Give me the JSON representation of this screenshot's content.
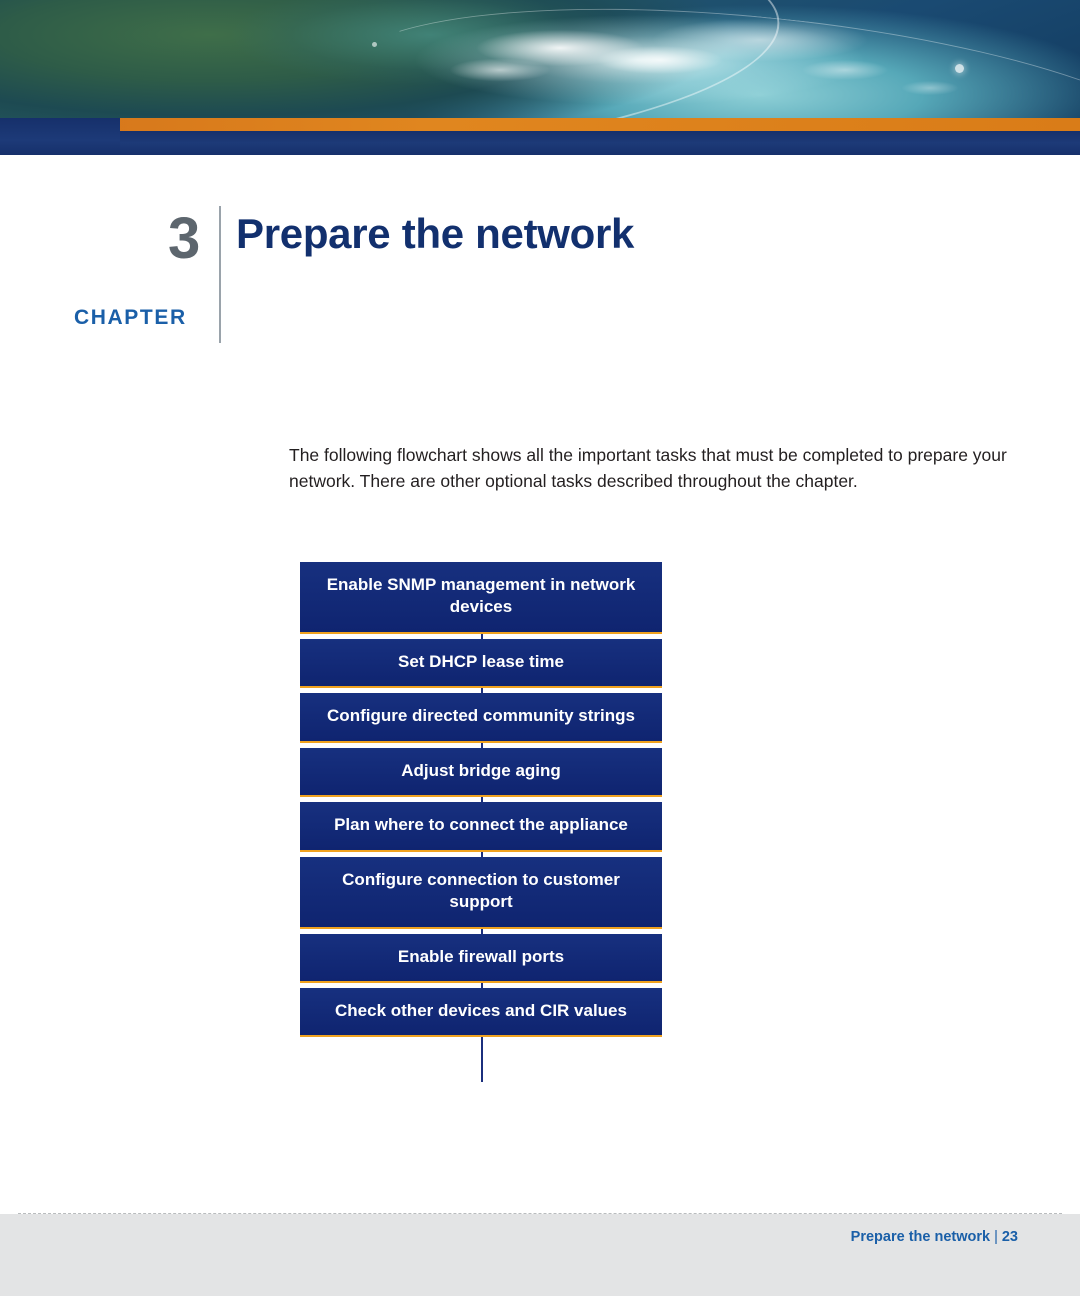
{
  "banner": {
    "icon_names": [
      "ocean-wave-photo",
      "sky-gradient",
      "orange-rule",
      "navy-rule",
      "light-dot"
    ]
  },
  "chapter": {
    "label": "CHAPTER",
    "number": "3",
    "title": "Prepare the network"
  },
  "intro": {
    "text": "The following flowchart shows all the important tasks that must be completed to prepare your network. There are other optional tasks described throughout the chapter."
  },
  "flowchart": {
    "type": "vertical-sequence",
    "accent_color": "#f0a21f",
    "box_color": "#132a7d",
    "text_color": "#ffffff",
    "steps": [
      "Enable SNMP management in network devices",
      "Set DHCP lease time",
      "Configure directed community strings",
      "Adjust bridge aging",
      "Plan where to connect the appliance",
      "Configure connection to customer support",
      "Enable firewall ports",
      "Check other devices and CIR values"
    ]
  },
  "footer": {
    "title": "Prepare the network",
    "separator": "|",
    "page": "23",
    "accent_color": "#1a5fa8"
  }
}
